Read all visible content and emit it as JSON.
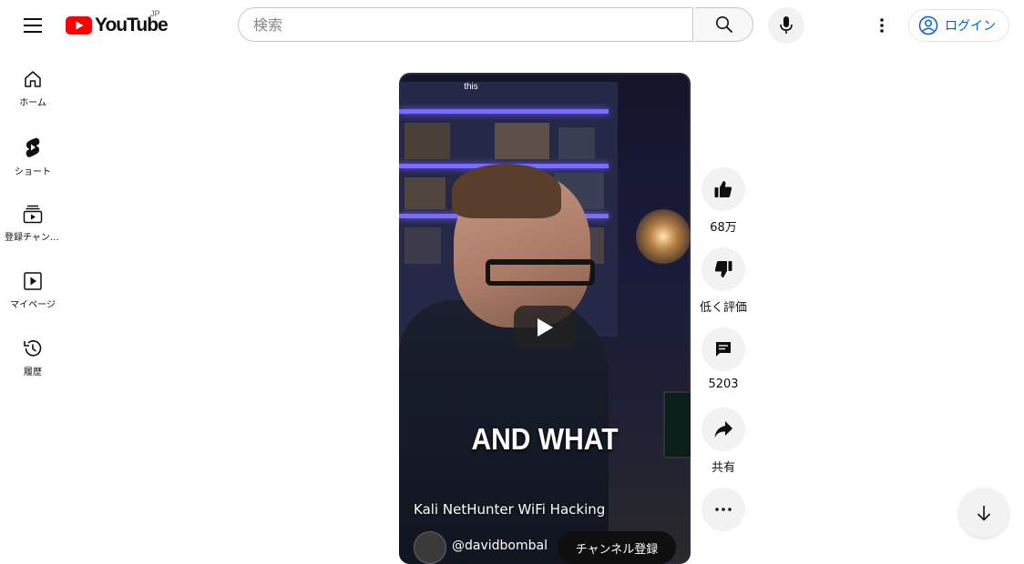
{
  "header": {
    "logo_text": "YouTube",
    "region": "JP",
    "search_placeholder": "検索",
    "login_label": "ログイン"
  },
  "sidebar": {
    "items": [
      {
        "label": "ホーム",
        "icon": "home-icon"
      },
      {
        "label": "ショート",
        "icon": "shorts-icon"
      },
      {
        "label": "登録チャンネル",
        "icon": "subscriptions-icon"
      },
      {
        "label": "マイページ",
        "icon": "library-icon"
      },
      {
        "label": "履歴",
        "icon": "history-icon"
      }
    ]
  },
  "short": {
    "top_caption": "this",
    "overlay_caption": "AND WHAT",
    "title": "Kali NetHunter WiFi Hacking",
    "channel_name": "@davidbombal",
    "subscribe_label": "チャンネル登録"
  },
  "actions": {
    "like_count": "68万",
    "dislike_label": "低く評価",
    "comment_count": "5203",
    "share_label": "共有"
  },
  "colors": {
    "brand_red": "#ff0000",
    "link_blue": "#065fd4",
    "button_gray": "#f2f2f2"
  }
}
